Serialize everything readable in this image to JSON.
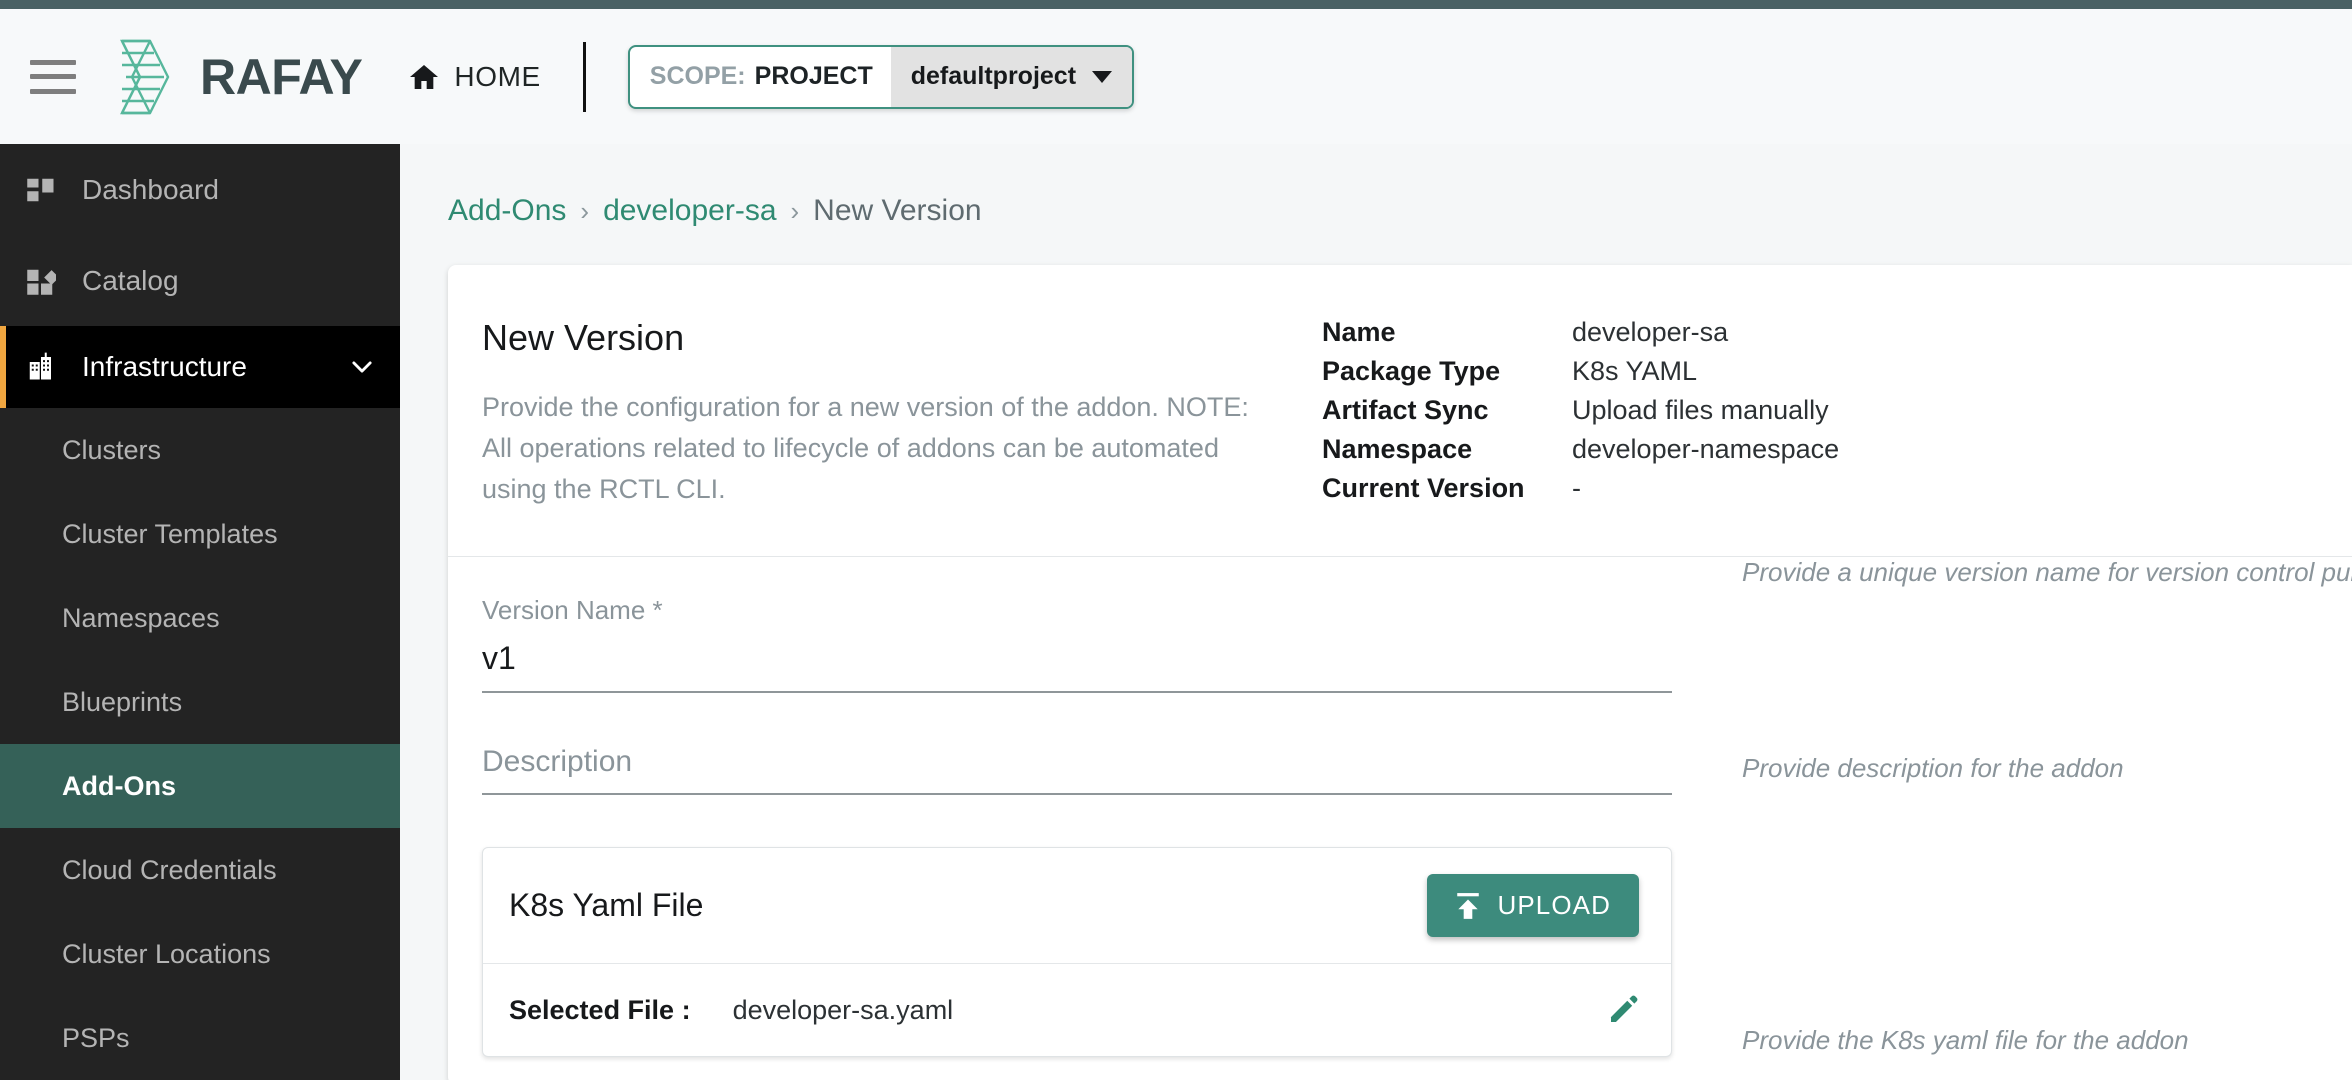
{
  "header": {
    "menu_icon": "hamburger-icon",
    "logo_text": "RAFAY",
    "home_label": "HOME",
    "home_icon": "home-icon",
    "scope_prefix": "SCOPE:",
    "scope_type": "PROJECT",
    "scope_value": "defaultproject",
    "scope_caret_icon": "chevron-down-icon"
  },
  "sidebar": {
    "top_items": [
      {
        "label": "Dashboard",
        "icon": "dashboard-grid-icon"
      },
      {
        "label": "Catalog",
        "icon": "catalog-diamond-icon"
      }
    ],
    "group": {
      "label": "Infrastructure",
      "icon": "building-icon",
      "chevron": "chevron-down-icon"
    },
    "sub_items": [
      {
        "label": "Clusters",
        "active": false
      },
      {
        "label": "Cluster Templates",
        "active": false
      },
      {
        "label": "Namespaces",
        "active": false
      },
      {
        "label": "Blueprints",
        "active": false
      },
      {
        "label": "Add-Ons",
        "active": true
      },
      {
        "label": "Cloud Credentials",
        "active": false
      },
      {
        "label": "Cluster Locations",
        "active": false
      },
      {
        "label": "PSPs",
        "active": false
      }
    ]
  },
  "breadcrumb": {
    "item1": "Add-Ons",
    "sep1": "›",
    "item2": "developer-sa",
    "sep2": "›",
    "current": "New Version"
  },
  "card": {
    "title": "New Version",
    "description": "Provide the configuration for a new version of the addon. NOTE: All operations related to lifecycle of addons can be automated using the RCTL CLI.",
    "meta": [
      {
        "key": "Name",
        "value": "developer-sa"
      },
      {
        "key": "Package Type",
        "value": "K8s YAML"
      },
      {
        "key": "Artifact Sync",
        "value": "Upload files manually"
      },
      {
        "key": "Namespace",
        "value": "developer-namespace"
      },
      {
        "key": "Current Version",
        "value": "-"
      }
    ]
  },
  "form": {
    "version_name": {
      "label": "Version Name *",
      "value": "v1",
      "placeholder": "",
      "hint": "Provide a unique version name for version control purposes"
    },
    "description": {
      "label": "",
      "value": "",
      "placeholder": "Description",
      "hint": "Provide description for the addon"
    },
    "yaml_file": {
      "title": "K8s Yaml File",
      "upload_label": "UPLOAD",
      "upload_icon": "upload-icon",
      "selected_file_key": "Selected File :",
      "selected_file_value": "developer-sa.yaml",
      "edit_icon": "pencil-icon",
      "hint": "Provide the K8s yaml file for the addon"
    }
  },
  "colors": {
    "brand_teal": "#3d8b7d",
    "accent_orange": "#f0a640",
    "sidebar_bg": "#232323",
    "sidebar_active": "#356158",
    "link_green": "#2f8a72",
    "top_strip": "#4a6164"
  }
}
